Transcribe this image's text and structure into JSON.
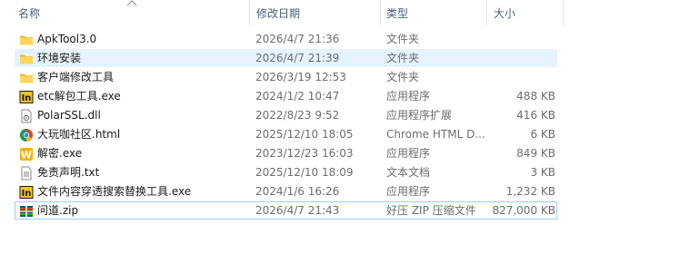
{
  "columns": {
    "name": "名称",
    "date": "修改日期",
    "type": "类型",
    "size": "大小"
  },
  "sort": {
    "column": "name",
    "direction": "ascending",
    "icon": "chevron-up-icon"
  },
  "files": [
    {
      "name": "ApkTool3.0",
      "date": "2026/4/7 21:36",
      "type": "文件夹",
      "size": "",
      "icon": "folder-icon",
      "state": "normal"
    },
    {
      "name": "环境安装",
      "date": "2026/4/7 21:39",
      "type": "文件夹",
      "size": "",
      "icon": "folder-icon",
      "state": "hover"
    },
    {
      "name": "客户端修改工具",
      "date": "2026/3/19 12:53",
      "type": "文件夹",
      "size": "",
      "icon": "folder-icon",
      "state": "normal"
    },
    {
      "name": "etc解包工具.exe",
      "date": "2024/1/2 10:47",
      "type": "应用程序",
      "size": "488 KB",
      "icon": "tool-app-icon",
      "state": "normal"
    },
    {
      "name": "PolarSSL.dll",
      "date": "2022/8/23 9:52",
      "type": "应用程序扩展",
      "size": "416 KB",
      "icon": "dll-file-icon",
      "state": "normal"
    },
    {
      "name": "大玩咖社区.html",
      "date": "2025/12/10 18:05",
      "type": "Chrome HTML D...",
      "size": "6 KB",
      "icon": "chrome-html-icon",
      "state": "normal"
    },
    {
      "name": "解密.exe",
      "date": "2023/12/23 16:03",
      "type": "应用程序",
      "size": "849 KB",
      "icon": "decrypt-app-icon",
      "state": "normal"
    },
    {
      "name": "免责声明.txt",
      "date": "2025/12/10 18:09",
      "type": "文本文档",
      "size": "3 KB",
      "icon": "text-file-icon",
      "state": "normal"
    },
    {
      "name": "文件内容穿透搜索替换工具.exe",
      "date": "2024/1/6 16:26",
      "type": "应用程序",
      "size": "1,232 KB",
      "icon": "tool-app-icon",
      "state": "normal"
    },
    {
      "name": "问道.zip",
      "date": "2026/4/7 21:43",
      "type": "好压 ZIP 压缩文件",
      "size": "827,000 KB",
      "icon": "zip-archive-icon",
      "state": "selected"
    }
  ]
}
